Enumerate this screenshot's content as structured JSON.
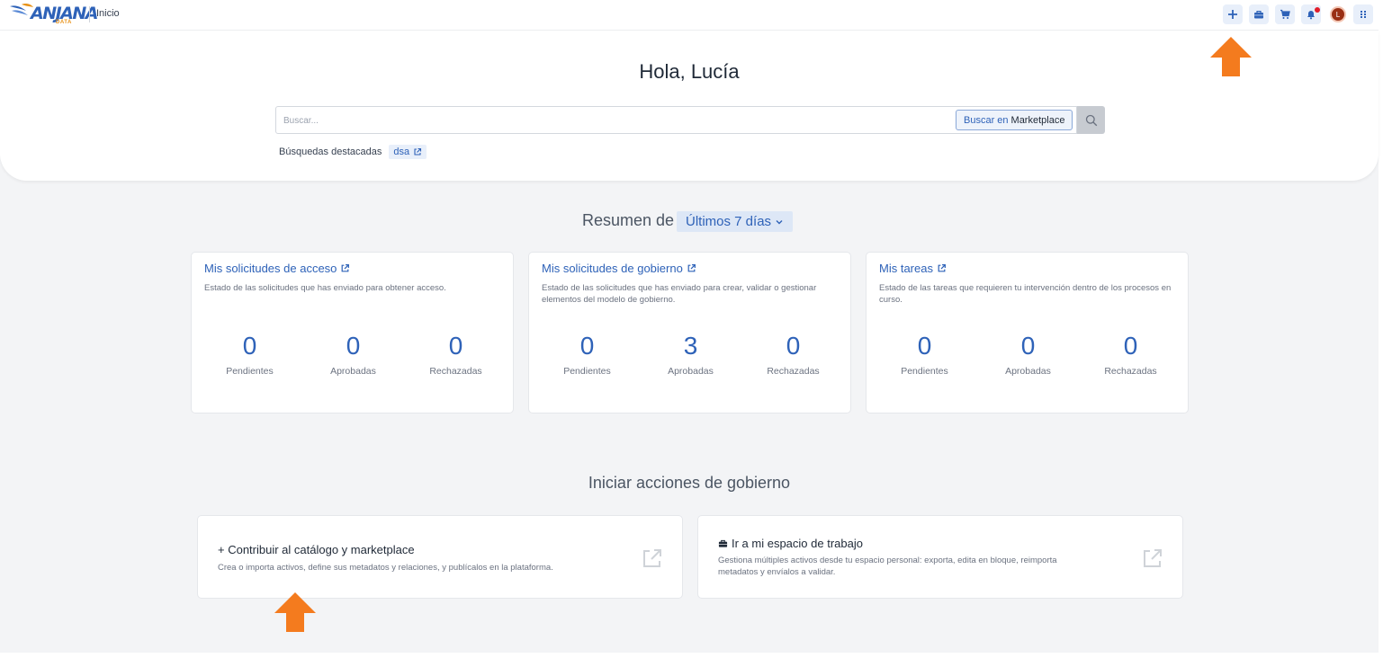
{
  "header": {
    "logo_text": "ANJANA",
    "logo_sub": "DATA",
    "breadcrumb": "Inicio"
  },
  "hero": {
    "greeting": "Hola, Lucía",
    "search": {
      "placeholder": "Buscar...",
      "value": "",
      "scope_prefix": "Buscar en",
      "scope_target": "Marketplace"
    },
    "featured_label": "Búsquedas destacadas",
    "featured_items": [
      "dsa"
    ]
  },
  "summary": {
    "title": "Resumen de",
    "period": "Últimos 7 días",
    "cards": [
      {
        "title": "Mis solicitudes de acceso",
        "description": "Estado de las solicitudes que has enviado para obtener acceso.",
        "stats": [
          {
            "value": "0",
            "label": "Pendientes"
          },
          {
            "value": "0",
            "label": "Aprobadas"
          },
          {
            "value": "0",
            "label": "Rechazadas"
          }
        ]
      },
      {
        "title": "Mis solicitudes de gobierno",
        "description": "Estado de las solicitudes que has enviado para crear, validar o gestionar elementos del modelo de gobierno.",
        "stats": [
          {
            "value": "0",
            "label": "Pendientes"
          },
          {
            "value": "3",
            "label": "Aprobadas"
          },
          {
            "value": "0",
            "label": "Rechazadas"
          }
        ]
      },
      {
        "title": "Mis tareas",
        "description": "Estado de las tareas que requieren tu intervención dentro de los procesos en curso.",
        "stats": [
          {
            "value": "0",
            "label": "Pendientes"
          },
          {
            "value": "0",
            "label": "Aprobadas"
          },
          {
            "value": "0",
            "label": "Rechazadas"
          }
        ]
      }
    ]
  },
  "actions": {
    "title": "Iniciar acciones de gobierno",
    "items": [
      {
        "title": "+ Contribuir al catálogo y marketplace",
        "description": "Crea o importa activos, define sus metadatos y relaciones, y publícalos en la plataforma."
      },
      {
        "title": "Ir a mi espacio de trabajo",
        "description": "Gestiona múltiples activos desde tu espacio personal: exporta, edita en bloque, reimporta metadatos y envíalos a validar."
      }
    ]
  },
  "user": {
    "avatar_initial": "L"
  },
  "colors": {
    "accent": "#2e62b8",
    "background": "#f3f4f6",
    "annotation_arrow": "#f47b1e",
    "avatar": "#9a2f14"
  }
}
